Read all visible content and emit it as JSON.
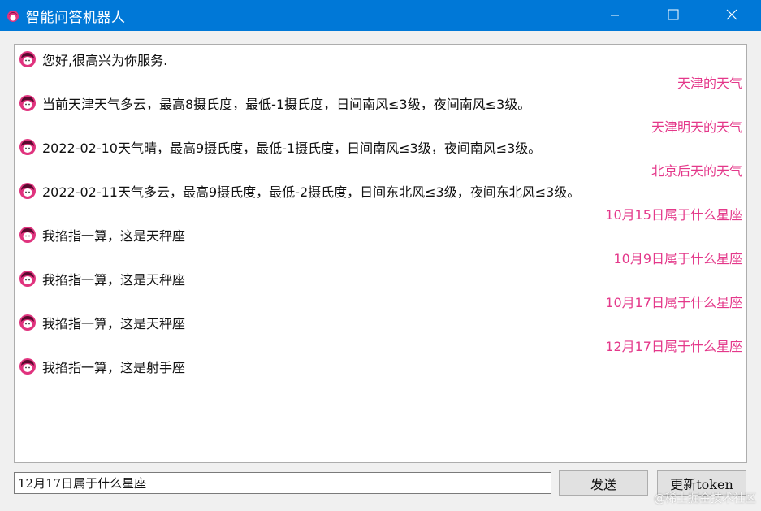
{
  "window": {
    "title": "智能问答机器人"
  },
  "colors": {
    "titlebar": "#0078d7",
    "user_text": "#e4388a",
    "avatar": "#e0337e"
  },
  "messages": [
    {
      "role": "bot",
      "text": "您好,很高兴为你服务."
    },
    {
      "role": "user",
      "text": "天津的天气"
    },
    {
      "role": "bot",
      "text": "当前天津天气多云，最高8摄氏度，最低-1摄氏度，日间南风≤3级，夜间南风≤3级。"
    },
    {
      "role": "user",
      "text": "天津明天的天气"
    },
    {
      "role": "bot",
      "text": "2022-02-10天气晴，最高9摄氏度，最低-1摄氏度，日间南风≤3级，夜间南风≤3级。"
    },
    {
      "role": "user",
      "text": "北京后天的天气"
    },
    {
      "role": "bot",
      "text": "2022-02-11天气多云，最高9摄氏度，最低-2摄氏度，日间东北风≤3级，夜间东北风≤3级。"
    },
    {
      "role": "user",
      "text": "10月15日属于什么星座"
    },
    {
      "role": "bot",
      "text": "我掐指一算，这是天秤座"
    },
    {
      "role": "user",
      "text": "10月9日属于什么星座"
    },
    {
      "role": "bot",
      "text": "我掐指一算，这是天秤座"
    },
    {
      "role": "user",
      "text": "10月17日属于什么星座"
    },
    {
      "role": "bot",
      "text": "我掐指一算，这是天秤座"
    },
    {
      "role": "user",
      "text": "12月17日属于什么星座"
    },
    {
      "role": "bot",
      "text": "我掐指一算，这是射手座"
    }
  ],
  "input": {
    "value": "12月17日属于什么星座"
  },
  "buttons": {
    "send": "发送",
    "refresh_token": "更新token"
  },
  "watermark": "@稀土掘金技术社区",
  "icons": {
    "app": "app-logo-icon",
    "avatar": "bot-avatar-icon",
    "minimize": "minimize-icon",
    "maximize": "maximize-icon",
    "close": "close-icon"
  }
}
